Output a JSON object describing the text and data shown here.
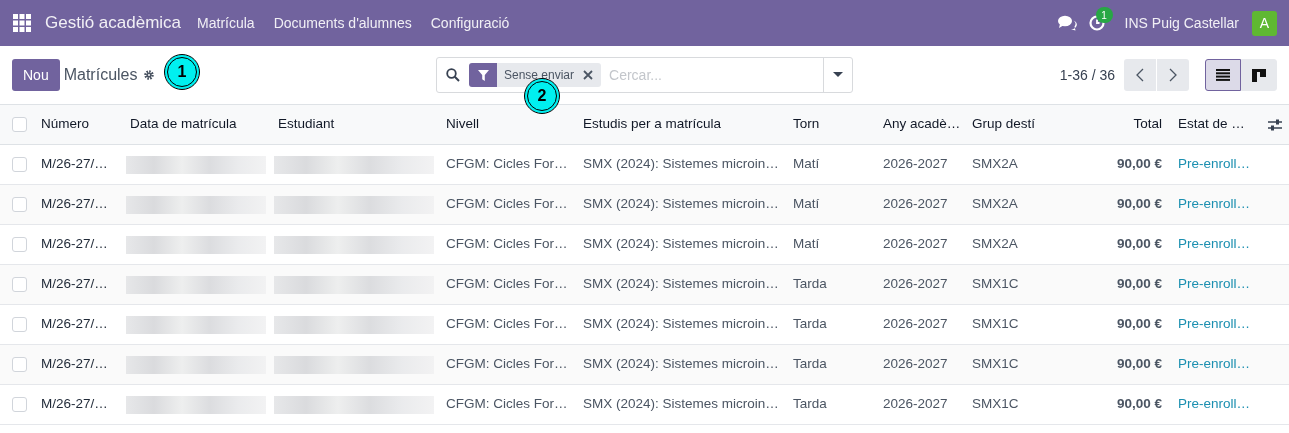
{
  "navbar": {
    "app_name": "Gestió acadèmica",
    "menus": [
      "Matrícula",
      "Documents d'alumnes",
      "Configuració"
    ],
    "activity_count": "1",
    "company": "INS Puig Castellar",
    "avatar_letter": "A"
  },
  "control_panel": {
    "new_button": "Nou",
    "title": "Matrícules",
    "search": {
      "facet": "Sense enviar",
      "placeholder": "Cercar..."
    },
    "pager": "1-36 / 36",
    "views": [
      {
        "kind": "list",
        "selected": true
      },
      {
        "kind": "kanban",
        "selected": false
      }
    ]
  },
  "callouts": [
    {
      "number": "1"
    },
    {
      "number": "2"
    }
  ],
  "table": {
    "all_checked": false,
    "columns": [
      {
        "label": "Número",
        "kind": "text"
      },
      {
        "label": "Data de matrícula",
        "kind": "text"
      },
      {
        "label": "Estudiant",
        "kind": "text"
      },
      {
        "label": "Nivell",
        "kind": "text"
      },
      {
        "label": "Estudis per a matrícula",
        "kind": "text"
      },
      {
        "label": "Torn",
        "kind": "text"
      },
      {
        "label": "Any acadè…",
        "kind": "text"
      },
      {
        "label": "Grup destí",
        "kind": "text"
      },
      {
        "label": "Total",
        "kind": "amount"
      },
      {
        "label": "Estat de …",
        "kind": "status"
      }
    ],
    "rows": [
      {
        "checked": false,
        "cells": [
          "M/26-27/…",
          null,
          null,
          "CFGM: Cicles For…",
          "SMX (2024): Sistemes microin…",
          "Matí",
          "2026-2027",
          "SMX2A",
          "90,00 €",
          "Pre-enroll…"
        ]
      },
      {
        "checked": false,
        "cells": [
          "M/26-27/…",
          null,
          null,
          "CFGM: Cicles For…",
          "SMX (2024): Sistemes microin…",
          "Matí",
          "2026-2027",
          "SMX2A",
          "90,00 €",
          "Pre-enroll…"
        ]
      },
      {
        "checked": false,
        "cells": [
          "M/26-27/…",
          null,
          null,
          "CFGM: Cicles For…",
          "SMX (2024): Sistemes microin…",
          "Matí",
          "2026-2027",
          "SMX2A",
          "90,00 €",
          "Pre-enroll…"
        ]
      },
      {
        "checked": false,
        "cells": [
          "M/26-27/…",
          null,
          null,
          "CFGM: Cicles For…",
          "SMX (2024): Sistemes microin…",
          "Tarda",
          "2026-2027",
          "SMX1C",
          "90,00 €",
          "Pre-enroll…"
        ]
      },
      {
        "checked": false,
        "cells": [
          "M/26-27/…",
          null,
          null,
          "CFGM: Cicles For…",
          "SMX (2024): Sistemes microin…",
          "Tarda",
          "2026-2027",
          "SMX1C",
          "90,00 €",
          "Pre-enroll…"
        ]
      },
      {
        "checked": false,
        "cells": [
          "M/26-27/…",
          null,
          null,
          "CFGM: Cicles For…",
          "SMX (2024): Sistemes microin…",
          "Tarda",
          "2026-2027",
          "SMX1C",
          "90,00 €",
          "Pre-enroll…"
        ]
      },
      {
        "checked": false,
        "cells": [
          "M/26-27/…",
          null,
          null,
          "CFGM: Cicles For…",
          "SMX (2024): Sistemes microin…",
          "Tarda",
          "2026-2027",
          "SMX1C",
          "90,00 €",
          "Pre-enroll…"
        ]
      }
    ]
  }
}
